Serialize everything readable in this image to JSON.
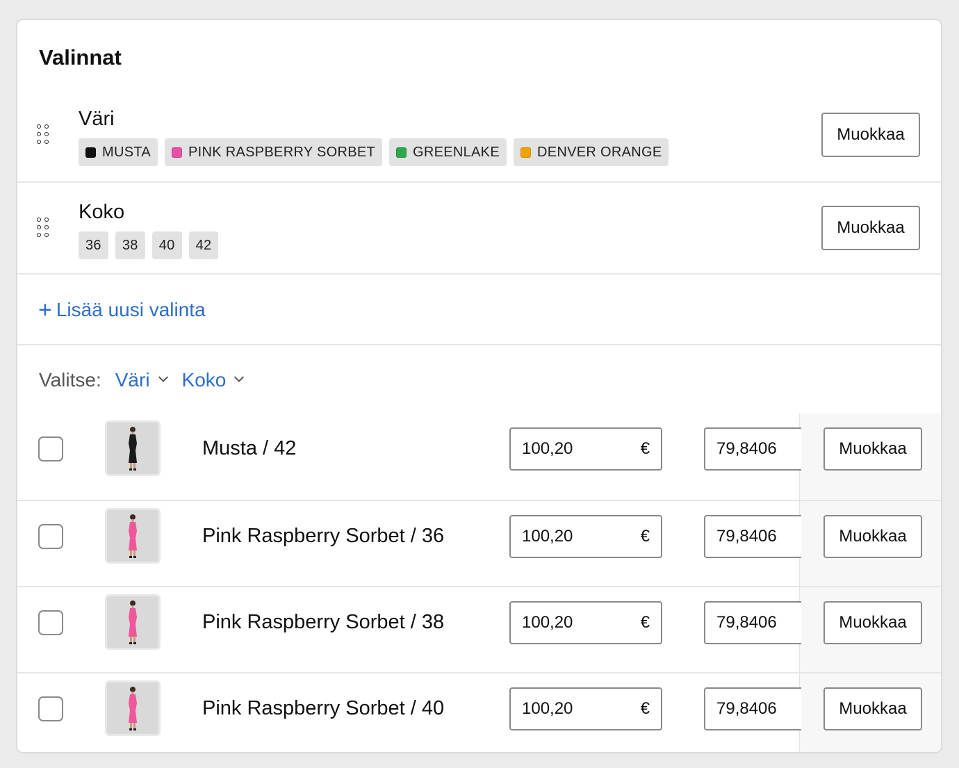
{
  "section": {
    "title": "Valinnat"
  },
  "options": [
    {
      "name": "Väri",
      "values": [
        {
          "label": "MUSTA",
          "color": "#111111"
        },
        {
          "label": "PINK RASPBERRY SORBET",
          "color": "#ea4fa8"
        },
        {
          "label": "GREENLAKE",
          "color": "#2ea84a"
        },
        {
          "label": "DENVER ORANGE",
          "color": "#f0a400"
        }
      ],
      "edit_label": "Muokkaa"
    },
    {
      "name": "Koko",
      "values": [
        {
          "label": "36"
        },
        {
          "label": "38"
        },
        {
          "label": "40"
        },
        {
          "label": "42"
        }
      ],
      "edit_label": "Muokkaa"
    }
  ],
  "add_option": {
    "label": "Lisää uusi valinta",
    "icon": "plus-icon"
  },
  "filters": {
    "label": "Valitse:",
    "items": [
      {
        "label": "Väri"
      },
      {
        "label": "Koko"
      }
    ]
  },
  "variants": [
    {
      "name": "Musta / 42",
      "price": "100,20",
      "currency": "€",
      "cost": "79,8406",
      "edit_label": "Muokkaa",
      "dress_color": "#1a1a1a"
    },
    {
      "name": "Pink Raspberry Sorbet / 36",
      "price": "100,20",
      "currency": "€",
      "cost": "79,8406",
      "edit_label": "Muokkaa",
      "dress_color": "#f0569a"
    },
    {
      "name": "Pink Raspberry Sorbet / 38",
      "price": "100,20",
      "currency": "€",
      "cost": "79,8406",
      "edit_label": "Muokkaa",
      "dress_color": "#f0569a"
    },
    {
      "name": "Pink Raspberry Sorbet / 40",
      "price": "100,20",
      "currency": "€",
      "cost": "79,8406",
      "edit_label": "Muokkaa",
      "dress_color": "#f0569a"
    }
  ]
}
